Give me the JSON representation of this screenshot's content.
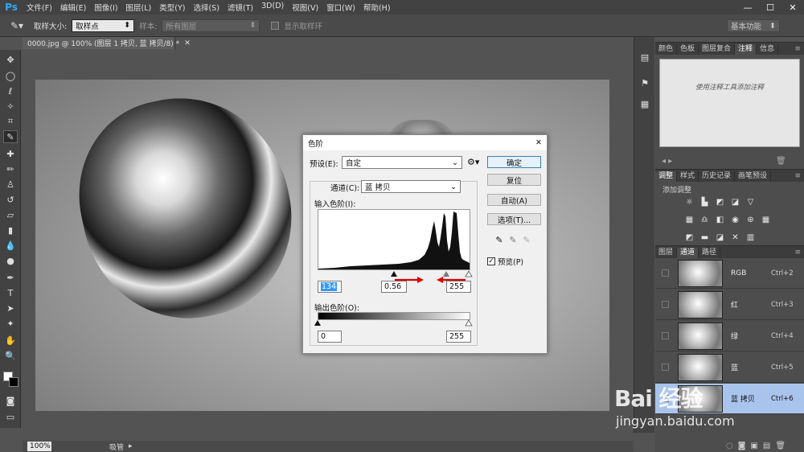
{
  "app": {
    "logo": "Ps",
    "menu": [
      "文件(F)",
      "编辑(E)",
      "图像(I)",
      "图层(L)",
      "类型(Y)",
      "选择(S)",
      "滤镜(T)",
      "3D(D)",
      "视图(V)",
      "窗口(W)",
      "帮助(H)"
    ],
    "window_controls": [
      "—",
      "☐",
      "✕"
    ]
  },
  "options_bar": {
    "tool_icon": "eyedropper-icon",
    "sample_size_label": "取样大小:",
    "sample_size_value": "取样点",
    "sample_label": "样本:",
    "sample_value": "所有图层",
    "show_ring_label": "显示取样环",
    "workspace": "基本功能"
  },
  "document": {
    "tab_title": "0000.jpg @ 100% (图层 1 拷贝, 蓝 拷贝/8) *",
    "zoom": "100%",
    "status": "吸管"
  },
  "levels_dialog": {
    "title": "色阶",
    "preset_label": "预设(E):",
    "preset_value": "自定",
    "channel_label": "通道(C):",
    "channel_value": "蓝 拷贝",
    "input_levels_label": "输入色阶(I):",
    "input_black": "134",
    "input_gamma": "0.56",
    "input_white": "255",
    "output_levels_label": "输出色阶(O):",
    "output_black": "0",
    "output_white": "255",
    "buttons": {
      "ok": "确定",
      "reset": "复位",
      "auto": "自动(A)",
      "options": "选项(T)..."
    },
    "preview_label": "预览(P)",
    "preview_checked": true
  },
  "panels": {
    "top_tabs": [
      "颜色",
      "色板",
      "图层复合",
      "注释",
      "信息"
    ],
    "top_active": "注释",
    "notes_hint": "使用注释工具添加注释",
    "adjust_tabs": [
      "调整",
      "样式",
      "历史记录",
      "画笔预设"
    ],
    "adjust_active": "调整",
    "add_adjustment": "添加调整",
    "layer_tabs": [
      "图层",
      "通道",
      "路径"
    ],
    "layer_active": "通道",
    "channels": [
      {
        "name": "RGB",
        "shortcut": "Ctrl+2",
        "selected": false
      },
      {
        "name": "红",
        "shortcut": "Ctrl+3",
        "selected": false
      },
      {
        "name": "绿",
        "shortcut": "Ctrl+4",
        "selected": false
      },
      {
        "name": "蓝",
        "shortcut": "Ctrl+5",
        "selected": false
      },
      {
        "name": "蓝 拷贝",
        "shortcut": "Ctrl+6",
        "selected": true
      }
    ]
  },
  "colors": {
    "arrow_red": "#e00000",
    "selection_blue": "#a9c4ec",
    "ps_blue": "#31a8ff"
  },
  "watermark": {
    "logo": "Bai 经验",
    "url": "jingyan.baidu.com"
  }
}
